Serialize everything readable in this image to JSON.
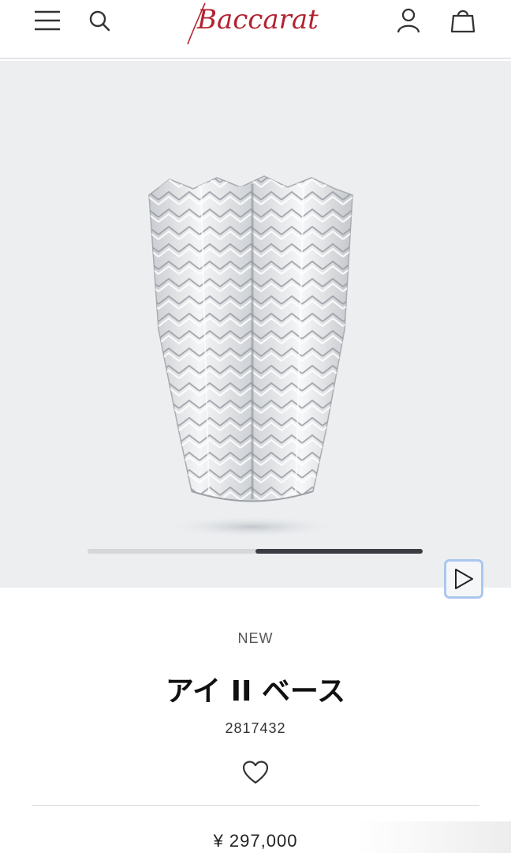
{
  "header": {
    "brand": "Baccarat",
    "icons": {
      "menu": "menu-icon",
      "search": "search-icon",
      "account": "account-icon",
      "bag": "shopping-bag-icon"
    }
  },
  "gallery": {
    "image_alt": "crystal-vase",
    "play_icon": "play-icon",
    "slide_progress": {
      "segments": 2,
      "active_index": 1
    }
  },
  "product": {
    "badge": "NEW",
    "name": "アイ II ベース",
    "sku": "2817432",
    "favorite_icon": "heart-icon",
    "price": "¥ 297,000"
  },
  "colors": {
    "brand_red": "#b22230",
    "hero_bg": "#eceef0",
    "play_border": "#a9c7ef"
  }
}
